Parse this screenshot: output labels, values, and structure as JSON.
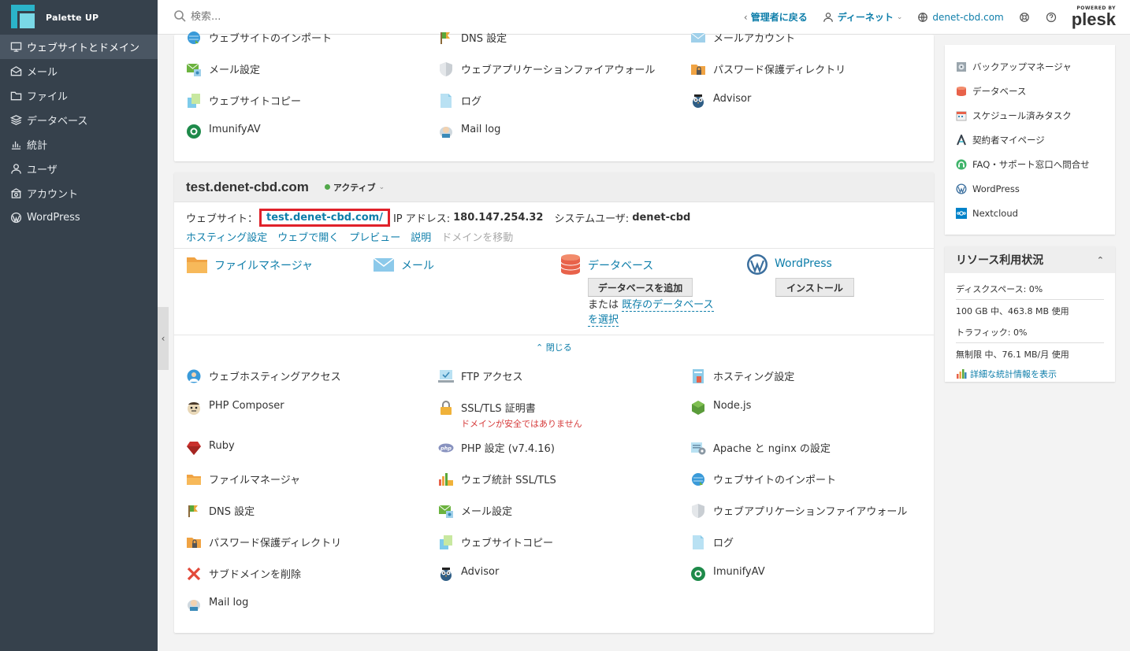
{
  "brand": {
    "name": "Palette UP"
  },
  "sidebar": {
    "items": [
      {
        "label": "ウェブサイトとドメイン",
        "icon": "monitor-icon",
        "active": true
      },
      {
        "label": "メール",
        "icon": "envelope-icon"
      },
      {
        "label": "ファイル",
        "icon": "folder-icon"
      },
      {
        "label": "データベース",
        "icon": "layers-icon"
      },
      {
        "label": "統計",
        "icon": "bar-chart-icon"
      },
      {
        "label": "ユーザ",
        "icon": "user-icon"
      },
      {
        "label": "アカウント",
        "icon": "account-icon"
      },
      {
        "label": "WordPress",
        "icon": "wordpress-icon"
      }
    ]
  },
  "header": {
    "search_placeholder": "検索...",
    "back_label": "管理者に戻る",
    "user_label": "ディーネット",
    "domain_label": "denet-cbd.com",
    "powered_by": "POWERED BY",
    "plesk": "plesk"
  },
  "top_tools": [
    {
      "label": "ウェブサイトのインポート",
      "icon": "globe-import-icon"
    },
    {
      "label": "DNS 設定",
      "icon": "dns-icon"
    },
    {
      "label": "メールアカウント",
      "icon": "mail-account-icon"
    },
    {
      "label": "メール設定",
      "icon": "mail-settings-icon"
    },
    {
      "label": "ウェブアプリケーションファイアウォール",
      "icon": "shield-icon"
    },
    {
      "label": "パスワード保護ディレクトリ",
      "icon": "locked-folder-icon"
    },
    {
      "label": "ウェブサイトコピー",
      "icon": "copy-icon"
    },
    {
      "label": "ログ",
      "icon": "log-icon"
    },
    {
      "label": "Advisor",
      "icon": "owl-icon"
    },
    {
      "label": "ImunifyAV",
      "icon": "imunify-icon"
    },
    {
      "label": "Mail log",
      "icon": "mail-log-icon"
    }
  ],
  "domain": {
    "name": "test.denet-cbd.com",
    "status": "アクティブ",
    "website_label": "ウェブサイト：",
    "website_url": "test.denet-cbd.com/",
    "ip_label": "IP アドレス:",
    "ip": "180.147.254.32",
    "sysuser_label": "システムユーザ:",
    "sysuser": "denet-cbd",
    "actions": [
      "ホスティング設定",
      "ウェブで開く",
      "プレビュー",
      "説明",
      "ドメインを移動"
    ],
    "quick": {
      "file_manager": "ファイルマネージャ",
      "mail": "メール",
      "database": "データベース",
      "add_db": "データベースを追加",
      "or": "または",
      "existing_db": "既存のデータベース",
      "select": "を選択",
      "wordpress": "WordPress",
      "install": "インストール"
    },
    "close_label": "閉じる"
  },
  "domain_tools": [
    {
      "label": "ウェブホスティングアクセス",
      "icon": "globe-user-icon"
    },
    {
      "label": "FTP アクセス",
      "icon": "ftp-icon"
    },
    {
      "label": "ホスティング設定",
      "icon": "hosting-settings-icon"
    },
    {
      "label": "PHP Composer",
      "icon": "composer-icon"
    },
    {
      "label": "SSL/TLS 証明書",
      "icon": "lock-icon",
      "sub": "ドメインが安全ではありません"
    },
    {
      "label": "Node.js",
      "icon": "nodejs-icon"
    },
    {
      "label": "Ruby",
      "icon": "ruby-icon"
    },
    {
      "label": "PHP 設定 (v7.4.16)",
      "icon": "php-icon"
    },
    {
      "label": "Apache と nginx の設定",
      "icon": "apache-icon"
    },
    {
      "label": "ファイルマネージャ",
      "icon": "folder-icon"
    },
    {
      "label": "ウェブ統計 SSL/TLS",
      "icon": "stats-icon"
    },
    {
      "label": "ウェブサイトのインポート",
      "icon": "globe-import-icon"
    },
    {
      "label": "DNS 設定",
      "icon": "dns-icon"
    },
    {
      "label": "メール設定",
      "icon": "mail-settings-icon"
    },
    {
      "label": "ウェブアプリケーションファイアウォール",
      "icon": "shield-icon"
    },
    {
      "label": "パスワード保護ディレクトリ",
      "icon": "locked-folder-icon"
    },
    {
      "label": "ウェブサイトコピー",
      "icon": "copy-icon"
    },
    {
      "label": "ログ",
      "icon": "log-icon"
    },
    {
      "label": "サブドメインを削除",
      "icon": "delete-icon"
    },
    {
      "label": "Advisor",
      "icon": "owl-icon"
    },
    {
      "label": "ImunifyAV",
      "icon": "imunify-icon"
    },
    {
      "label": "Mail log",
      "icon": "mail-log-icon"
    }
  ],
  "right_links": [
    {
      "label": "バックアップマネージャ",
      "icon": "backup-icon"
    },
    {
      "label": "データベース",
      "icon": "database-icon"
    },
    {
      "label": "スケジュール済みタスク",
      "icon": "calendar-icon"
    },
    {
      "label": "契約者マイページ",
      "icon": "mypage-icon"
    },
    {
      "label": "FAQ・サポート窓口へ問合せ",
      "icon": "support-icon"
    },
    {
      "label": "WordPress",
      "icon": "wordpress-icon"
    },
    {
      "label": "Nextcloud",
      "icon": "nextcloud-icon"
    }
  ],
  "resources": {
    "title": "リソース利用状況",
    "disk_label": "ディスクスペース: 0%",
    "disk_detail": "100 GB 中、463.8 MB 使用",
    "traffic_label": "トラフィック: 0%",
    "traffic_detail": "無制限 中、76.1 MB/月 使用",
    "stats_link": "詳細な統計情報を表示"
  },
  "colors": {
    "sidebar": "#36414c",
    "link": "#0e7eaa",
    "highlight": "#e0212a",
    "active_green": "#52a84a"
  }
}
